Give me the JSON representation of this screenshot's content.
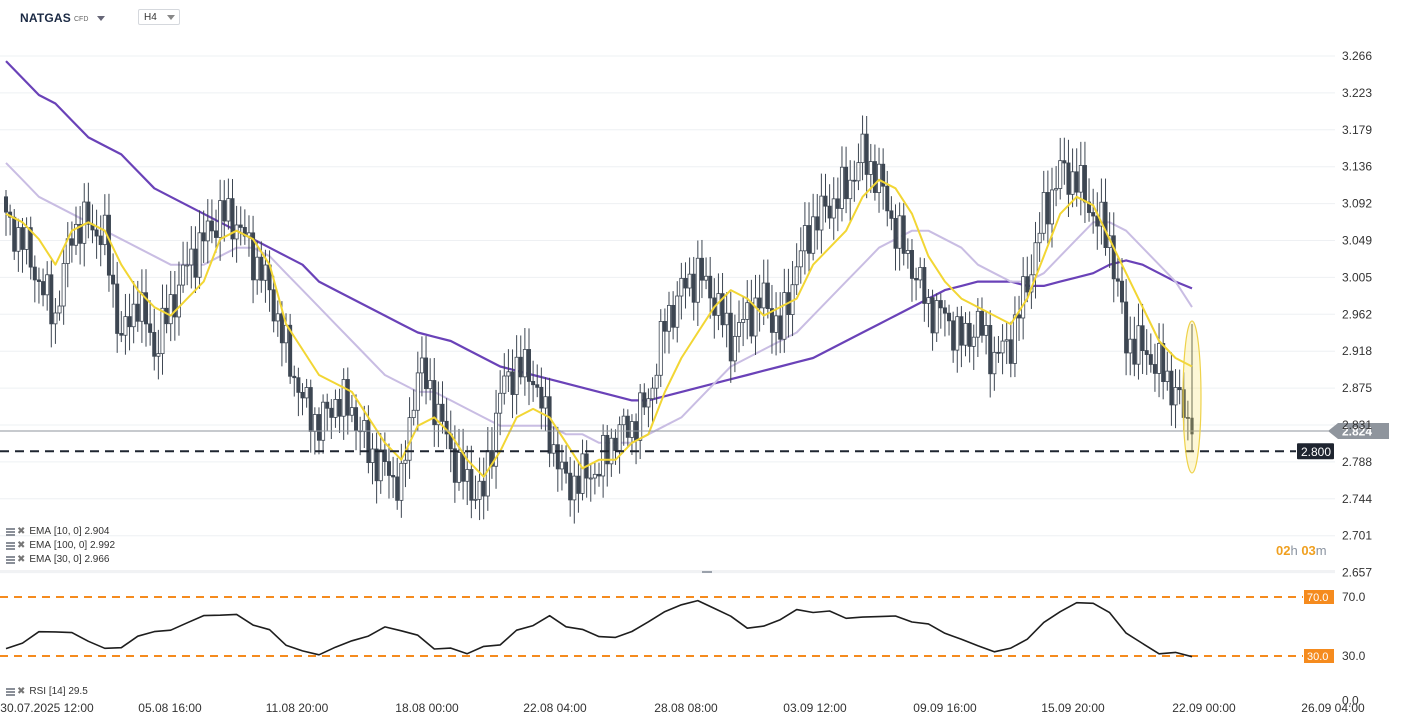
{
  "header": {
    "symbol": "NATGAS",
    "symbol_type": "CFD",
    "timeframe": "H4"
  },
  "legend": [
    {
      "label": "EMA",
      "params": "[10, 0]",
      "value": "2.904"
    },
    {
      "label": "EMA",
      "params": "[100, 0]",
      "value": "2.992"
    },
    {
      "label": "EMA",
      "params": "[30, 0]",
      "value": "2.966"
    }
  ],
  "rsi_legend": {
    "label": "RSI",
    "params": "[14]",
    "value": "29.5"
  },
  "countdown": {
    "hours": "02",
    "hours_unit": "h",
    "minutes": "03",
    "minutes_unit": "m"
  },
  "colors": {
    "candle": "#3d4652",
    "ema10": "#f2d634",
    "ema30": "#c9bde3",
    "ema100": "#6a42b8",
    "current_price_bg": "#8f959d",
    "level_bg": "#1f2530",
    "rsi_level": "#f58b1e",
    "rsi_line": "#1e1e1e"
  },
  "chart_data": [
    {
      "type": "candlestick",
      "title": "NATGAS",
      "timeframe": "H4",
      "price_ticks": [
        "3.266",
        "3.223",
        "3.179",
        "3.136",
        "3.092",
        "3.049",
        "3.005",
        "2.962",
        "2.918",
        "2.875",
        "2.831",
        "2.788",
        "2.744",
        "2.701",
        "2.657"
      ],
      "ylim": [
        2.657,
        3.266
      ],
      "time_ticks": [
        "30.07.2025 12:00",
        "05.08 16:00",
        "11.08 20:00",
        "18.08 00:00",
        "22.08 04:00",
        "28.08 08:00",
        "03.09 12:00",
        "09.09 16:00",
        "15.09 20:00",
        "22.09 00:00",
        "26.09 04:00"
      ],
      "current_price": "2.824",
      "horizontal_level": "2.800",
      "series": [
        {
          "name": "EMA [10, 0]",
          "last": 2.904,
          "values": [
            3.08,
            3.07,
            3.05,
            3.02,
            3.06,
            3.07,
            3.06,
            3.02,
            2.99,
            2.97,
            2.96,
            2.98,
            3.0,
            3.05,
            3.06,
            3.05,
            3.02,
            2.95,
            2.92,
            2.89,
            2.88,
            2.87,
            2.84,
            2.81,
            2.79,
            2.83,
            2.84,
            2.82,
            2.79,
            2.77,
            2.8,
            2.84,
            2.85,
            2.84,
            2.81,
            2.78,
            2.79,
            2.79,
            2.81,
            2.82,
            2.87,
            2.91,
            2.94,
            2.97,
            2.99,
            2.98,
            2.96,
            2.97,
            2.98,
            3.02,
            3.04,
            3.06,
            3.1,
            3.12,
            3.11,
            3.08,
            3.03,
            3.0,
            2.98,
            2.97,
            2.96,
            2.95,
            2.98,
            3.03,
            3.08,
            3.1,
            3.09,
            3.05,
            3.01,
            2.97,
            2.93,
            2.91,
            2.9
          ]
        },
        {
          "name": "EMA [30, 0]",
          "last": 2.966,
          "values": [
            3.14,
            3.12,
            3.1,
            3.09,
            3.08,
            3.07,
            3.06,
            3.05,
            3.04,
            3.03,
            3.02,
            3.02,
            3.02,
            3.03,
            3.04,
            3.04,
            3.03,
            3.01,
            2.99,
            2.97,
            2.95,
            2.93,
            2.91,
            2.89,
            2.88,
            2.87,
            2.87,
            2.86,
            2.85,
            2.84,
            2.83,
            2.83,
            2.83,
            2.83,
            2.82,
            2.82,
            2.81,
            2.81,
            2.81,
            2.82,
            2.83,
            2.84,
            2.86,
            2.88,
            2.9,
            2.91,
            2.92,
            2.93,
            2.94,
            2.96,
            2.98,
            3.0,
            3.02,
            3.04,
            3.05,
            3.06,
            3.06,
            3.05,
            3.04,
            3.02,
            3.01,
            3.0,
            3.0,
            3.01,
            3.03,
            3.05,
            3.07,
            3.07,
            3.06,
            3.04,
            3.02,
            3.0,
            2.97
          ]
        },
        {
          "name": "EMA [100, 0]",
          "last": 2.992,
          "values": [
            3.26,
            3.24,
            3.22,
            3.21,
            3.19,
            3.17,
            3.16,
            3.15,
            3.13,
            3.11,
            3.1,
            3.09,
            3.08,
            3.07,
            3.06,
            3.05,
            3.04,
            3.03,
            3.02,
            3.0,
            2.99,
            2.98,
            2.97,
            2.96,
            2.95,
            2.94,
            2.935,
            2.93,
            2.92,
            2.91,
            2.9,
            2.895,
            2.89,
            2.885,
            2.88,
            2.875,
            2.87,
            2.865,
            2.86,
            2.86,
            2.865,
            2.87,
            2.875,
            2.88,
            2.885,
            2.89,
            2.895,
            2.9,
            2.905,
            2.91,
            2.92,
            2.93,
            2.94,
            2.95,
            2.96,
            2.97,
            2.98,
            2.99,
            2.995,
            3.0,
            3.0,
            3.0,
            2.995,
            2.995,
            3.0,
            3.005,
            3.01,
            3.02,
            3.025,
            3.02,
            3.01,
            3.0,
            2.992
          ]
        }
      ],
      "close": [
        3.07,
        3.05,
        3.0,
        2.96,
        3.06,
        3.07,
        3.05,
        2.93,
        2.98,
        2.92,
        2.97,
        3.02,
        3.05,
        3.08,
        3.07,
        3.03,
        2.99,
        2.92,
        2.86,
        2.83,
        2.86,
        2.85,
        2.8,
        2.78,
        2.76,
        2.9,
        2.86,
        2.8,
        2.76,
        2.75,
        2.87,
        2.9,
        2.89,
        2.82,
        2.76,
        2.77,
        2.78,
        2.82,
        2.83,
        2.86,
        2.95,
        2.99,
        3.01,
        2.98,
        2.93,
        2.96,
        2.98,
        2.94,
        3.02,
        3.07,
        3.09,
        3.11,
        3.15,
        3.12,
        3.06,
        3.02,
        2.97,
        2.96,
        2.93,
        2.95,
        2.91,
        2.93,
        3.0,
        3.08,
        3.13,
        3.12,
        3.08,
        3.05,
        2.93,
        2.92,
        2.9,
        2.87,
        2.82
      ]
    },
    {
      "type": "line",
      "title": "RSI",
      "name": "RSI [14]",
      "last": 29.5,
      "ylim": [
        0,
        100
      ],
      "y_ticks": [
        "0.0",
        "30.0",
        "70.0"
      ],
      "levels": [
        70.0,
        30.0
      ],
      "values": [
        35,
        39,
        46,
        47,
        45,
        41,
        34,
        37,
        42,
        48,
        46,
        54,
        56,
        59,
        57,
        52,
        47,
        38,
        33,
        31,
        36,
        40,
        44,
        49,
        48,
        43,
        36,
        34,
        33,
        35,
        39,
        46,
        52,
        56,
        51,
        47,
        44,
        42,
        47,
        53,
        60,
        65,
        67,
        63,
        56,
        50,
        49,
        56,
        60,
        61,
        59,
        57,
        55,
        58,
        56,
        54,
        51,
        46,
        41,
        37,
        33,
        35,
        42,
        52,
        61,
        65,
        67,
        58,
        47,
        37,
        33,
        31,
        29.5
      ]
    }
  ]
}
